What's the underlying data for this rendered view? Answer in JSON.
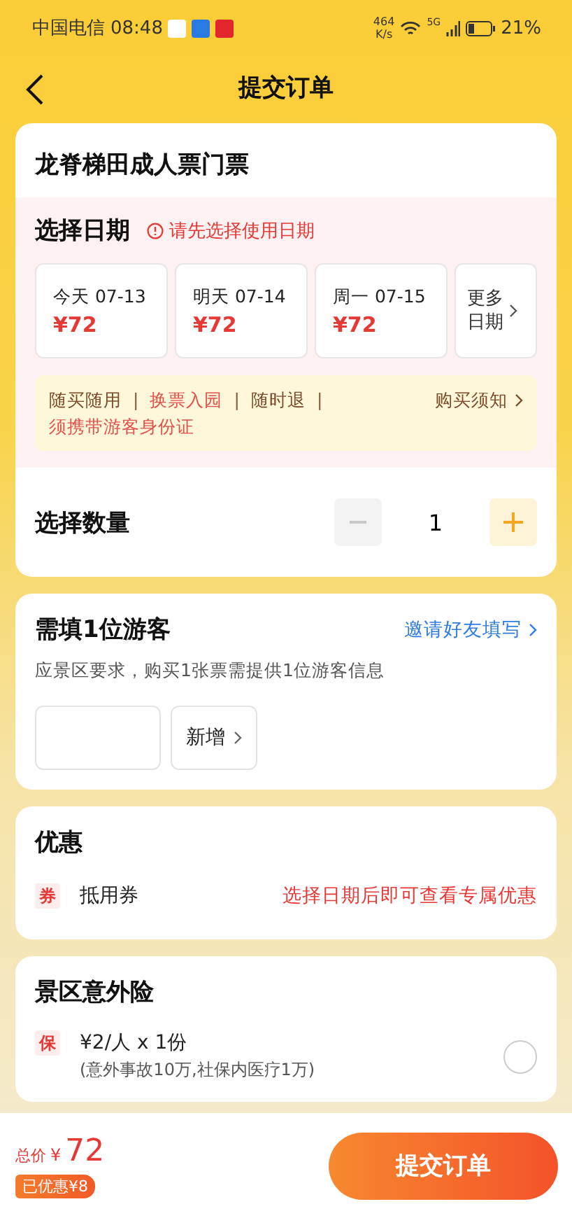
{
  "status_bar": {
    "carrier": "中国电信",
    "time": "08:48",
    "speed": "464",
    "speed_unit": "K/s",
    "network": "5G",
    "battery": "21%"
  },
  "header": {
    "title": "提交订单"
  },
  "ticket": {
    "name": "龙脊梯田成人票门票",
    "date_section": {
      "title": "选择日期",
      "warning": "请先选择使用日期",
      "dates": [
        {
          "label": "今天 07-13",
          "price": "¥72",
          "selected": false
        },
        {
          "label": "明天 07-14",
          "price": "¥72",
          "selected": false
        },
        {
          "label": "周一 07-15",
          "price": "¥72",
          "selected": false
        }
      ],
      "more": "更多日期",
      "notices": [
        {
          "kind": "tag",
          "text": "随买随用",
          "highlight": false
        },
        {
          "kind": "separator",
          "text": "|"
        },
        {
          "kind": "tag",
          "text": "换票入园",
          "highlight": true
        },
        {
          "kind": "separator",
          "text": "|"
        },
        {
          "kind": "tag",
          "text": "随时退",
          "highlight": false
        },
        {
          "kind": "separator",
          "text": "|"
        },
        {
          "kind": "tag",
          "text": "须携带游客身份证",
          "highlight": true
        }
      ],
      "notice_link": "购买须知"
    },
    "quantity": {
      "label": "选择数量",
      "value": "1",
      "minus_disabled": true
    }
  },
  "visitors": {
    "title": "需填1位游客",
    "invite": "邀请好友填写",
    "hint": "应景区要求，购买1张票需提供1位游客信息",
    "add": "新增"
  },
  "discount": {
    "title": "优惠",
    "tag": "券",
    "label": "抵用券",
    "note": "选择日期后即可查看专属优惠"
  },
  "insurance": {
    "title": "景区意外险",
    "tag": "保",
    "price": "¥2/人 x 1份",
    "detail": "(意外事故10万,社保内医疗1万)",
    "checked": false
  },
  "footer": {
    "total_label": "总价",
    "currency": "¥",
    "total": "72",
    "saved": "已优惠¥8",
    "submit": "提交订单"
  }
}
